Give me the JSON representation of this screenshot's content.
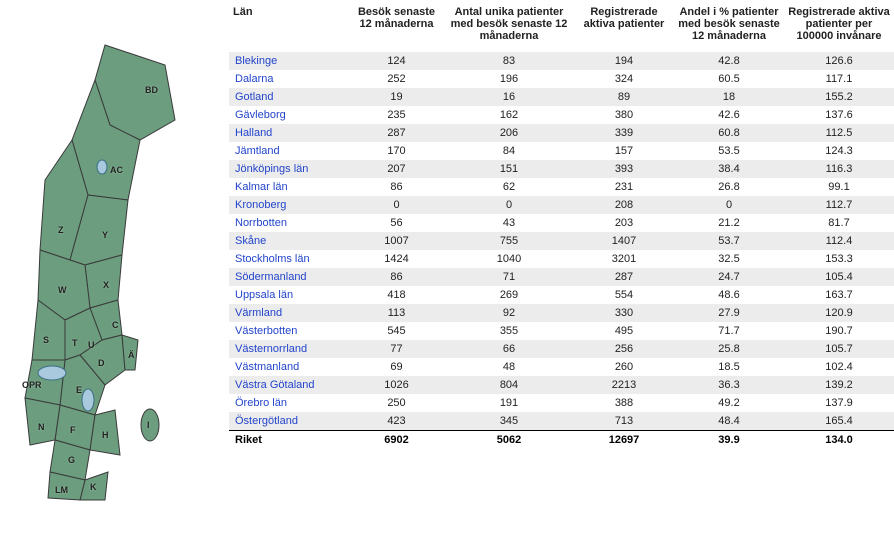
{
  "table": {
    "headers": [
      "Län",
      "Besök senaste 12 månaderna",
      "Antal unika patienter med besök senaste 12 månaderna",
      "Registrerade aktiva patienter",
      "Andel i % patienter med besök senaste 12 månaderna",
      "Registrerade aktiva patienter per 100000 invånare"
    ],
    "rows": [
      {
        "lan": "Blekinge",
        "v1": "124",
        "v2": "83",
        "v3": "194",
        "v4": "42.8",
        "v5": "126.6"
      },
      {
        "lan": "Dalarna",
        "v1": "252",
        "v2": "196",
        "v3": "324",
        "v4": "60.5",
        "v5": "117.1"
      },
      {
        "lan": "Gotland",
        "v1": "19",
        "v2": "16",
        "v3": "89",
        "v4": "18",
        "v5": "155.2"
      },
      {
        "lan": "Gävleborg",
        "v1": "235",
        "v2": "162",
        "v3": "380",
        "v4": "42.6",
        "v5": "137.6"
      },
      {
        "lan": "Halland",
        "v1": "287",
        "v2": "206",
        "v3": "339",
        "v4": "60.8",
        "v5": "112.5"
      },
      {
        "lan": "Jämtland",
        "v1": "170",
        "v2": "84",
        "v3": "157",
        "v4": "53.5",
        "v5": "124.3"
      },
      {
        "lan": "Jönköpings län",
        "v1": "207",
        "v2": "151",
        "v3": "393",
        "v4": "38.4",
        "v5": "116.3"
      },
      {
        "lan": "Kalmar län",
        "v1": "86",
        "v2": "62",
        "v3": "231",
        "v4": "26.8",
        "v5": "99.1"
      },
      {
        "lan": "Kronoberg",
        "v1": "0",
        "v2": "0",
        "v3": "208",
        "v4": "0",
        "v5": "112.7"
      },
      {
        "lan": "Norrbotten",
        "v1": "56",
        "v2": "43",
        "v3": "203",
        "v4": "21.2",
        "v5": "81.7"
      },
      {
        "lan": "Skåne",
        "v1": "1007",
        "v2": "755",
        "v3": "1407",
        "v4": "53.7",
        "v5": "112.4"
      },
      {
        "lan": "Stockholms län",
        "v1": "1424",
        "v2": "1040",
        "v3": "3201",
        "v4": "32.5",
        "v5": "153.3"
      },
      {
        "lan": "Södermanland",
        "v1": "86",
        "v2": "71",
        "v3": "287",
        "v4": "24.7",
        "v5": "105.4"
      },
      {
        "lan": "Uppsala län",
        "v1": "418",
        "v2": "269",
        "v3": "554",
        "v4": "48.6",
        "v5": "163.7"
      },
      {
        "lan": "Värmland",
        "v1": "113",
        "v2": "92",
        "v3": "330",
        "v4": "27.9",
        "v5": "120.9"
      },
      {
        "lan": "Västerbotten",
        "v1": "545",
        "v2": "355",
        "v3": "495",
        "v4": "71.7",
        "v5": "190.7"
      },
      {
        "lan": "Västernorrland",
        "v1": "77",
        "v2": "66",
        "v3": "256",
        "v4": "25.8",
        "v5": "105.7"
      },
      {
        "lan": "Västmanland",
        "v1": "69",
        "v2": "48",
        "v3": "260",
        "v4": "18.5",
        "v5": "102.4"
      },
      {
        "lan": "Västra Götaland",
        "v1": "1026",
        "v2": "804",
        "v3": "2213",
        "v4": "36.3",
        "v5": "139.2"
      },
      {
        "lan": "Örebro län",
        "v1": "250",
        "v2": "191",
        "v3": "388",
        "v4": "49.2",
        "v5": "137.9"
      },
      {
        "lan": "Östergötland",
        "v1": "423",
        "v2": "345",
        "v3": "713",
        "v4": "48.4",
        "v5": "165.4"
      }
    ],
    "total": {
      "lan": "Riket",
      "v1": "6902",
      "v2": "5062",
      "v3": "12697",
      "v4": "39.9",
      "v5": "134.0"
    }
  },
  "map": {
    "labels": [
      "BD",
      "AC",
      "Z",
      "Y",
      "X",
      "W",
      "S",
      "C",
      "T",
      "U",
      "D",
      "Ä",
      "E",
      "OPR",
      "F",
      "H",
      "N",
      "G",
      "K",
      "I",
      "LM"
    ]
  }
}
